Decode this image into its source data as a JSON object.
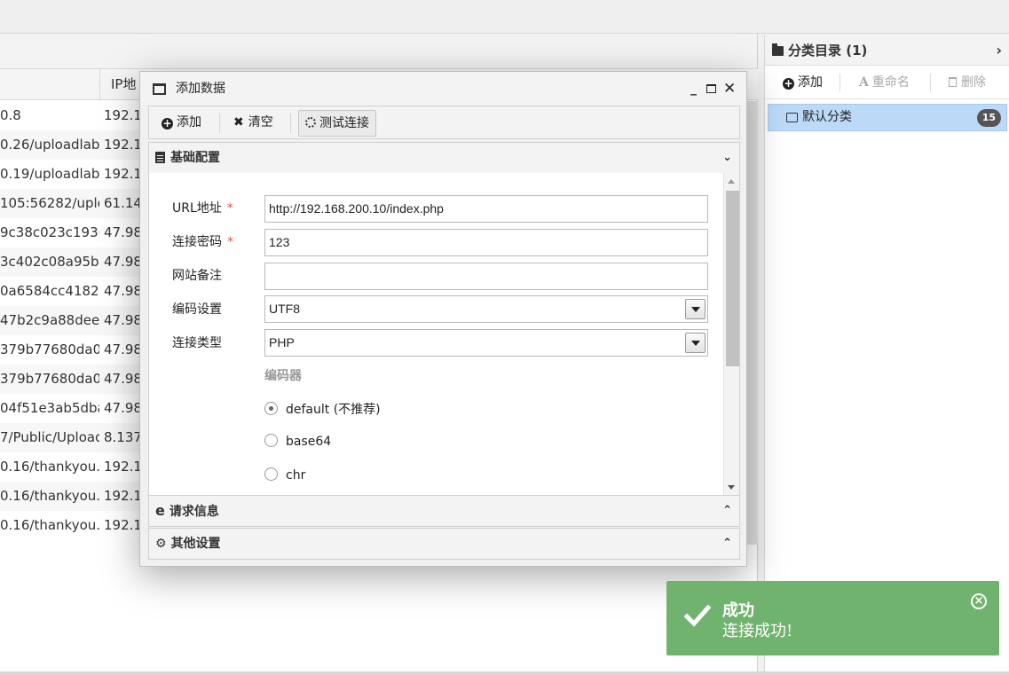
{
  "grid": {
    "column_ip_header": "IP地",
    "rows": [
      {
        "url": "0.8",
        "ip": "192.1"
      },
      {
        "url": "0.26/uploadlabs,",
        "ip": "192.1"
      },
      {
        "url": "0.19/uploadlabs,",
        "ip": "192.1"
      },
      {
        "url": "105:56282/uplo",
        "ip": "61.14"
      },
      {
        "url": "9c38c023c1936!",
        "ip": "47.98"
      },
      {
        "url": "3c402c08a95b3(",
        "ip": "47.98"
      },
      {
        "url": "0a6584cc4182f8",
        "ip": "47.98"
      },
      {
        "url": "47b2c9a88dee2",
        "ip": "47.98"
      },
      {
        "url": "379b77680da0(",
        "ip": "47.98"
      },
      {
        "url": "379b77680da0(",
        "ip": "47.98"
      },
      {
        "url": "04f51e3ab5dba8",
        "ip": "47.98"
      },
      {
        "url": "7/Public/Upload",
        "ip": "8.137"
      },
      {
        "url": "0.16/thankyou.p",
        "ip": "192.1"
      },
      {
        "url": "0.16/thankyou.p",
        "ip": "192.1"
      },
      {
        "url": "0.16/thankyou.p",
        "ip": "192.1"
      }
    ]
  },
  "category": {
    "title": "分类目录 (1)",
    "add_label": "添加",
    "rename_label": "重命名",
    "delete_label": "删除",
    "items": [
      {
        "label": "默认分类",
        "count": "15"
      }
    ]
  },
  "modal": {
    "title": "添加数据",
    "toolbar": {
      "add_label": "添加",
      "clear_label": "清空",
      "test_label": "测试连接"
    },
    "sections": {
      "basic": "基础配置",
      "request": "请求信息",
      "other": "其他设置"
    },
    "form": {
      "url_label": "URL地址",
      "url_value": "http://192.168.200.10/index.php",
      "password_label": "连接密码",
      "password_value": "123",
      "note_label": "网站备注",
      "note_value": "",
      "encoding_label": "编码设置",
      "encoding_value": "UTF8",
      "type_label": "连接类型",
      "type_value": "PHP",
      "encoder_title": "编码器",
      "required_mark": "*",
      "encoders": [
        {
          "label": "default (不推荐)",
          "selected": true
        },
        {
          "label": "base64",
          "selected": false
        },
        {
          "label": "chr",
          "selected": false
        }
      ]
    }
  },
  "toast": {
    "title": "成功",
    "message": "连接成功!",
    "color": "#70b36e"
  }
}
